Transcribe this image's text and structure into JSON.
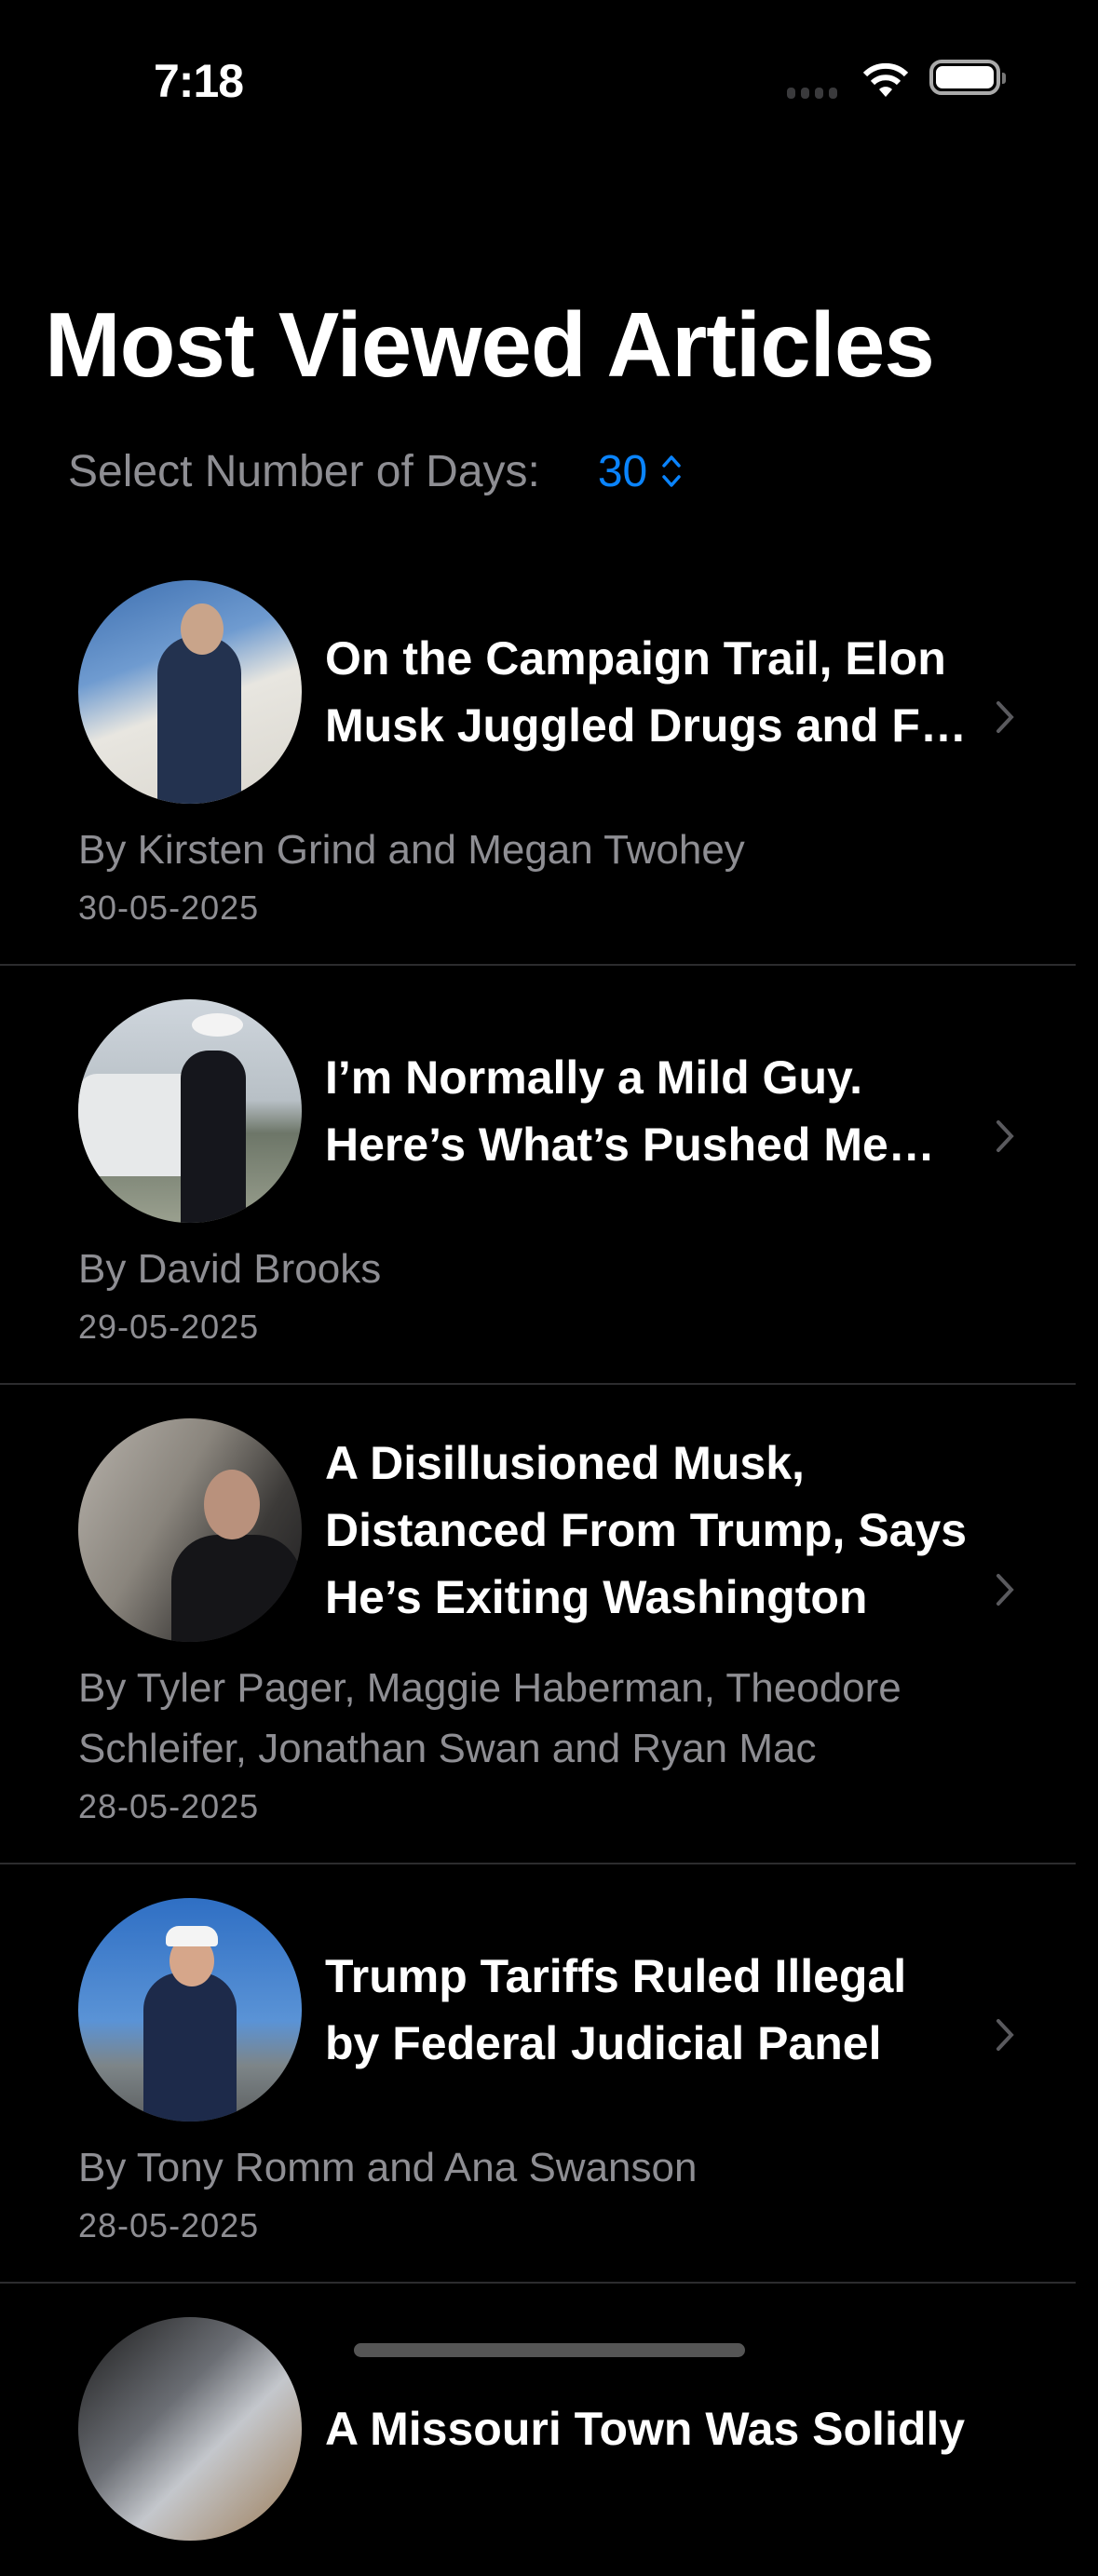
{
  "status_bar": {
    "time": "7:18"
  },
  "header": {
    "title": "Most Viewed Articles"
  },
  "days_picker": {
    "label": "Select Number of Days:",
    "value": "30"
  },
  "articles": [
    {
      "title": "On the Campaign Trail, Elon Musk Juggled Drugs and F…",
      "author": "By Kirsten Grind and Megan Twohey",
      "date": "30-05-2025"
    },
    {
      "title": "I’m Normally a Mild Guy. Here’s What’s Pushed Me…",
      "author": "By David Brooks",
      "date": "29-05-2025"
    },
    {
      "title": "A Disillusioned Musk, Distanced From Trump, Says He’s Exiting Washington",
      "author": "By Tyler Pager, Maggie Haberman, Theodore Schleifer, Jonathan Swan and Ryan Mac",
      "date": "28-05-2025"
    },
    {
      "title": "Trump Tariffs Ruled Illegal by Federal Judicial Panel",
      "author": "By Tony Romm and Ana Swanson",
      "date": "28-05-2025"
    },
    {
      "title": "A Missouri Town Was Solidly",
      "author": "",
      "date": ""
    }
  ],
  "colors": {
    "accent": "#0a84ff",
    "secondary_text": "#8e8e93",
    "background": "#000000"
  }
}
